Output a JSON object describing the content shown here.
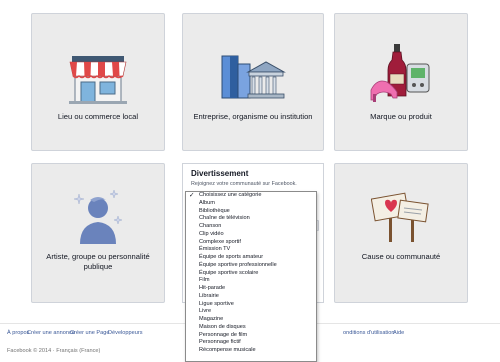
{
  "tiles": {
    "local": {
      "label": "Lieu ou commerce local"
    },
    "company": {
      "label": "Entreprise, organisme ou institution"
    },
    "brand": {
      "label": "Marque ou produit"
    },
    "artist": {
      "label": "Artiste, groupe ou personnalité publique"
    },
    "entertainment": {
      "title": "Divertissement",
      "subtitle": "Rejoignez votre communauté sur Facebook.",
      "dropdown": {
        "selected": "Choisissez une catégorie",
        "options": [
          "Choisissez une catégorie",
          "Album",
          "Bibliothèque",
          "Chaîne de télévision",
          "Chanson",
          "Clip vidéo",
          "Complexe sportif",
          "Émission TV",
          "Équipe de sports amateur",
          "Équipe sportive professionnelle",
          "Équipe sportive scolaire",
          "Film",
          "Hit-parade",
          "Librairie",
          "Ligue sportive",
          "Livre",
          "Magazine",
          "Maison de disques",
          "Personnage de film",
          "Personnage fictif",
          "Récompense musicale"
        ]
      }
    },
    "cause": {
      "label": "Cause ou communauté"
    }
  },
  "footer": {
    "links": [
      "À propos",
      "Créer une annonce",
      "Créer une Page",
      "Développeurs",
      "onditions d'utilisation",
      "Aide"
    ],
    "copyright": "Facebook © 2014 · Français (France)"
  },
  "colors": {
    "tile_bg": "#ebebeb",
    "link": "#3b5998",
    "awning_red": "#e04848",
    "building_blue": "#5b8ed6",
    "heel_pink": "#ef6fb0",
    "bottle_red": "#a01d3b"
  }
}
